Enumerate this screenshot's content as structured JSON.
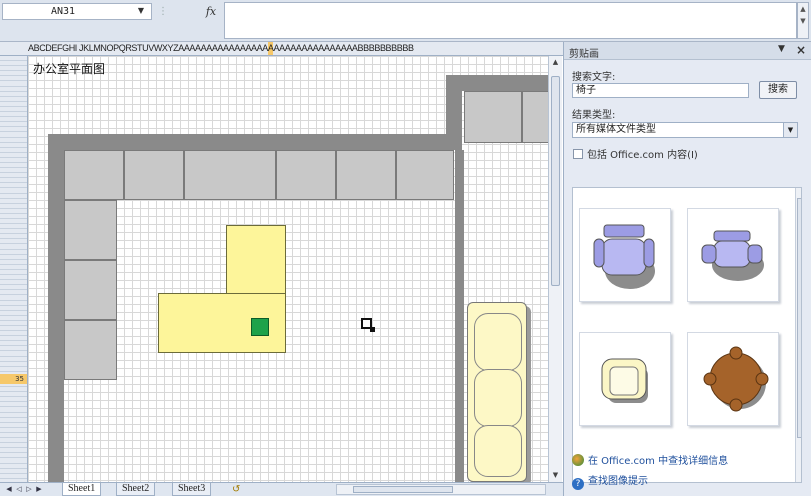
{
  "formula_bar": {
    "name_box": "AN31",
    "fx_label": "fx",
    "formula": ""
  },
  "grid": {
    "column_header_pre": "ABCDEFGHI JKLMNOPQRSTUVWXYZAAAAAAAAAAAAAAAA",
    "column_header_highlight": "A",
    "column_header_post": "AAAAAAAAAAAAAAABBBBBBBBBB",
    "selected_row": "35",
    "sheet_title": "办公室平面图"
  },
  "sheet_tabs": {
    "tabs": [
      "Sheet1",
      "Sheet2",
      "Sheet3"
    ],
    "active": "Sheet1"
  },
  "clip_art_pane": {
    "title": "剪贴画",
    "search_label": "搜索文字:",
    "search_value": "椅子",
    "search_button": "搜索",
    "result_type_label": "结果类型:",
    "result_type_value": "所有媒体文件类型",
    "include_office_label": "包括 Office.com 内容(I)",
    "link_office": "在 Office.com 中查找详细信息",
    "link_tips": "查找图像提示",
    "clips": [
      "chair-purple-swivel",
      "chair-purple-armchair",
      "chair-yellow-armchair",
      "chair-brown-round"
    ]
  },
  "colors": {
    "wall": "#8a8a8a",
    "desk": "#fdf59a",
    "accent_green": "#1ea24a",
    "sofa": "#fdf8c6",
    "header_highlight": "#f6c86a"
  }
}
